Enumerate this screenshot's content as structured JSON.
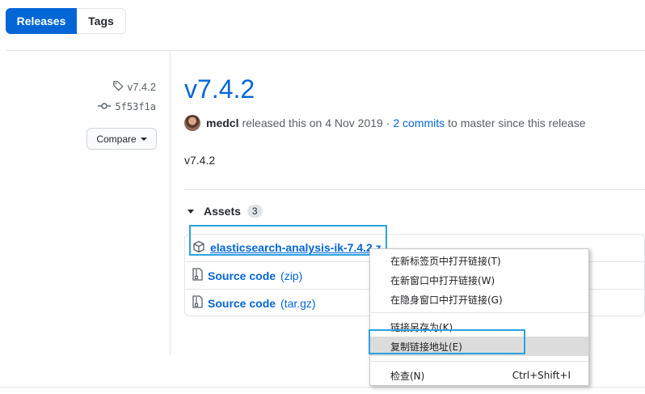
{
  "tabs": {
    "releases": "Releases",
    "tags": "Tags"
  },
  "meta": {
    "tag": "v7.4.2",
    "commit": "5f53f1a",
    "compare_label": "Compare"
  },
  "release": {
    "title": "v7.4.2",
    "author": "medcl",
    "released_text": "released this on 4 Nov 2019 ·",
    "commits_link": "2 commits",
    "since_text": "to master since this release",
    "body": "v7.4.2"
  },
  "assets": {
    "heading": "Assets",
    "count": "3",
    "items": [
      {
        "name": "elasticsearch-analysis-ik-7.4.2.z",
        "kind": ""
      },
      {
        "name": "Source code",
        "kind": "(zip)"
      },
      {
        "name": "Source code",
        "kind": "(tar.gz)"
      }
    ]
  },
  "context_menu": {
    "items": [
      {
        "label": "在新标签页中打开链接(T)",
        "shortcut": ""
      },
      {
        "label": "在新窗口中打开链接(W)",
        "shortcut": ""
      },
      {
        "label": "在隐身窗口中打开链接(G)",
        "shortcut": ""
      },
      {
        "label": "链接另存为(K)...",
        "shortcut": ""
      },
      {
        "label": "复制链接地址(E)",
        "shortcut": ""
      },
      {
        "label": "检查(N)",
        "shortcut": "Ctrl+Shift+I"
      }
    ],
    "selected_index": 4
  },
  "colors": {
    "accent": "#0366d6",
    "annotation": "#2aa2e2",
    "menu_selected": "#dcdcdc"
  },
  "icons": [
    "tag-icon",
    "git-commit-icon",
    "caret-down-icon",
    "package-icon",
    "file-zip-icon"
  ]
}
